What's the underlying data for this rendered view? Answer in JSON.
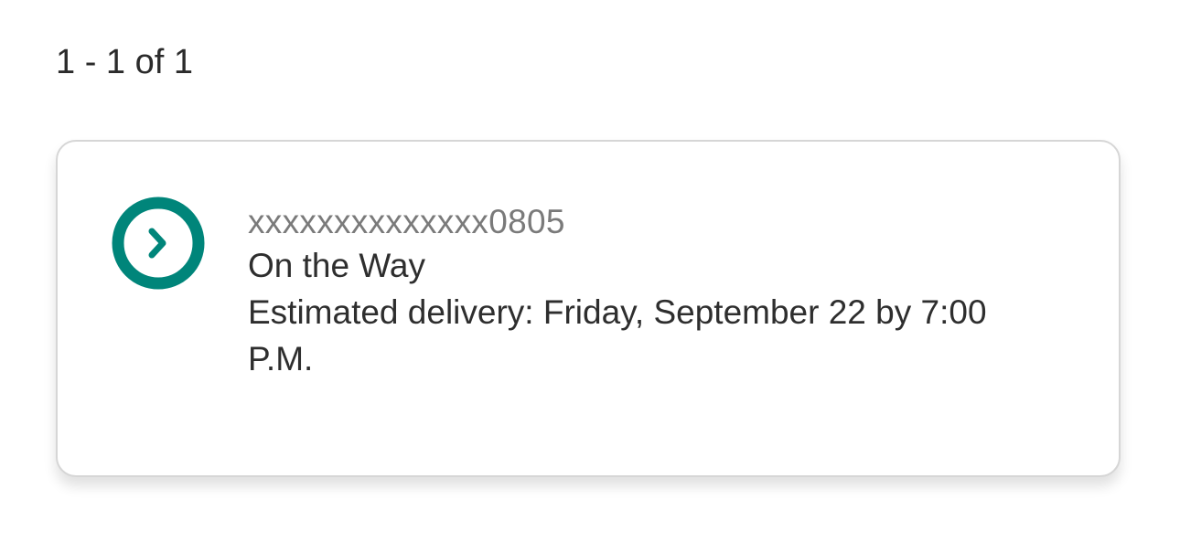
{
  "results": {
    "count_text": "1 - 1 of 1"
  },
  "shipment": {
    "tracking_number": "xxxxxxxxxxxxxx0805",
    "status": "On the Way",
    "estimated_delivery": "Estimated delivery: Friday, September 22 by 7:00 P.M.",
    "icon": "chevron-right-circle-icon",
    "accent_color": "#00857a"
  }
}
